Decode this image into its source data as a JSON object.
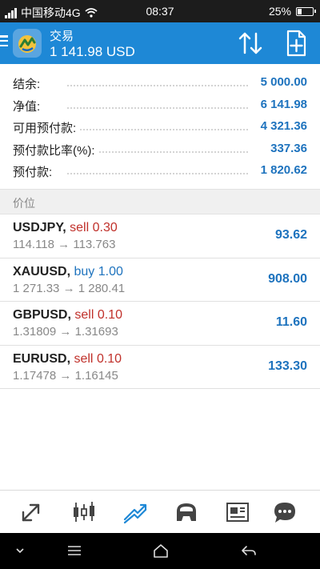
{
  "status_bar": {
    "carrier": "中国移动4G",
    "time": "08:37",
    "battery": "25%",
    "battery_level": 0.25
  },
  "header": {
    "title": "交易",
    "balance": "1 141.98 USD",
    "icons": [
      "menu-icon",
      "metatrader-logo",
      "sort-icon",
      "new-order-icon"
    ]
  },
  "summary": [
    {
      "label": "结余:",
      "value": "5 000.00"
    },
    {
      "label": "净值:",
      "value": "6 141.98"
    },
    {
      "label": "可用预付款:",
      "value": "4 321.36"
    },
    {
      "label": "预付款比率(%):",
      "value": "337.36"
    },
    {
      "label": "预付款:",
      "value": "1 820.62"
    }
  ],
  "section": {
    "title": "价位"
  },
  "positions": [
    {
      "symbol": "USDJPY,",
      "side": "sell",
      "volume": "0.30",
      "open": "114.118",
      "arrow": "→",
      "current": "113.763",
      "profit": "93.62"
    },
    {
      "symbol": "XAUUSD,",
      "side": "buy",
      "volume": "1.00",
      "open": "1 271.33",
      "arrow": "→",
      "current": "1 280.41",
      "profit": "908.00"
    },
    {
      "symbol": "GBPUSD,",
      "side": "sell",
      "volume": "0.10",
      "open": "1.31809",
      "arrow": "→",
      "current": "1.31693",
      "profit": "11.60"
    },
    {
      "symbol": "EURUSD,",
      "side": "sell",
      "volume": "0.10",
      "open": "1.17478",
      "arrow": "→",
      "current": "1.16145",
      "profit": "133.30"
    }
  ],
  "bottom_tabs": {
    "icons": [
      "quotes-icon",
      "chart-icon",
      "trade-icon",
      "history-icon",
      "news-icon",
      "chat-icon"
    ],
    "active": "trade-icon"
  },
  "colors": {
    "header_bg": "#1e88d6",
    "value_blue": "#1e73be",
    "sell_red": "#c0302a",
    "status_bar_bg": "#1c1c1c",
    "nav_bar_bg": "#000000"
  }
}
